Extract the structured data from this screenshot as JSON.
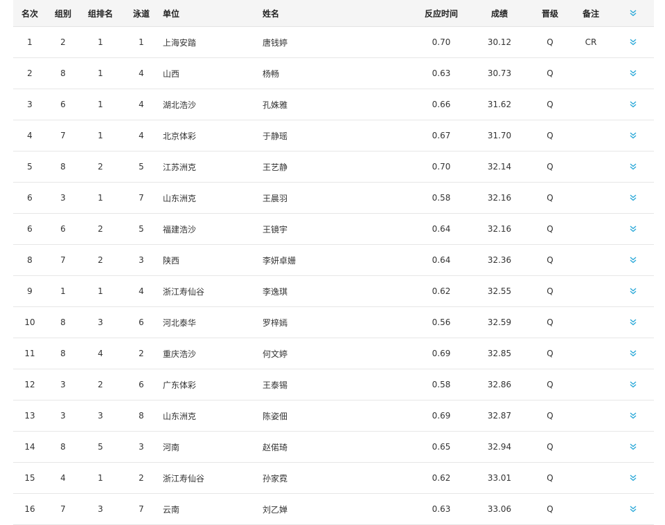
{
  "accent_color": "#29a8d8",
  "expand_icon": "double-chevron-down-icon",
  "header": {
    "rank": "名次",
    "group": "组别",
    "group_rank": "组排名",
    "lane": "泳道",
    "unit": "单位",
    "name": "姓名",
    "reaction": "反应时间",
    "result": "成绩",
    "advance": "晋级",
    "note": "备注"
  },
  "rows": [
    {
      "rank": "1",
      "group": "2",
      "group_rank": "1",
      "lane": "1",
      "unit": "上海安踏",
      "name": "唐钱婷",
      "reaction": "0.70",
      "result": "30.12",
      "advance": "Q",
      "note": "CR"
    },
    {
      "rank": "2",
      "group": "8",
      "group_rank": "1",
      "lane": "4",
      "unit": "山西",
      "name": "杨畅",
      "reaction": "0.63",
      "result": "30.73",
      "advance": "Q",
      "note": ""
    },
    {
      "rank": "3",
      "group": "6",
      "group_rank": "1",
      "lane": "4",
      "unit": "湖北浩沙",
      "name": "孔姝雅",
      "reaction": "0.66",
      "result": "31.62",
      "advance": "Q",
      "note": ""
    },
    {
      "rank": "4",
      "group": "7",
      "group_rank": "1",
      "lane": "4",
      "unit": "北京体彩",
      "name": "于静瑶",
      "reaction": "0.67",
      "result": "31.70",
      "advance": "Q",
      "note": ""
    },
    {
      "rank": "5",
      "group": "8",
      "group_rank": "2",
      "lane": "5",
      "unit": "江苏洲克",
      "name": "王艺静",
      "reaction": "0.70",
      "result": "32.14",
      "advance": "Q",
      "note": ""
    },
    {
      "rank": "6",
      "group": "3",
      "group_rank": "1",
      "lane": "7",
      "unit": "山东洲克",
      "name": "王晨羽",
      "reaction": "0.58",
      "result": "32.16",
      "advance": "Q",
      "note": ""
    },
    {
      "rank": "6",
      "group": "6",
      "group_rank": "2",
      "lane": "5",
      "unit": "福建浩沙",
      "name": "王镜宇",
      "reaction": "0.64",
      "result": "32.16",
      "advance": "Q",
      "note": ""
    },
    {
      "rank": "8",
      "group": "7",
      "group_rank": "2",
      "lane": "3",
      "unit": "陕西",
      "name": "李妍卓姗",
      "reaction": "0.64",
      "result": "32.36",
      "advance": "Q",
      "note": ""
    },
    {
      "rank": "9",
      "group": "1",
      "group_rank": "1",
      "lane": "4",
      "unit": "浙江寿仙谷",
      "name": "李逸琪",
      "reaction": "0.62",
      "result": "32.55",
      "advance": "Q",
      "note": ""
    },
    {
      "rank": "10",
      "group": "8",
      "group_rank": "3",
      "lane": "6",
      "unit": "河北泰华",
      "name": "罗梓嫣",
      "reaction": "0.56",
      "result": "32.59",
      "advance": "Q",
      "note": ""
    },
    {
      "rank": "11",
      "group": "8",
      "group_rank": "4",
      "lane": "2",
      "unit": "重庆浩沙",
      "name": "何文婷",
      "reaction": "0.69",
      "result": "32.85",
      "advance": "Q",
      "note": ""
    },
    {
      "rank": "12",
      "group": "3",
      "group_rank": "2",
      "lane": "6",
      "unit": "广东体彩",
      "name": "王泰锡",
      "reaction": "0.58",
      "result": "32.86",
      "advance": "Q",
      "note": ""
    },
    {
      "rank": "13",
      "group": "3",
      "group_rank": "3",
      "lane": "8",
      "unit": "山东洲克",
      "name": "陈姿佃",
      "reaction": "0.69",
      "result": "32.87",
      "advance": "Q",
      "note": ""
    },
    {
      "rank": "14",
      "group": "8",
      "group_rank": "5",
      "lane": "3",
      "unit": "河南",
      "name": "赵偌琦",
      "reaction": "0.65",
      "result": "32.94",
      "advance": "Q",
      "note": ""
    },
    {
      "rank": "15",
      "group": "4",
      "group_rank": "1",
      "lane": "2",
      "unit": "浙江寿仙谷",
      "name": "孙家霓",
      "reaction": "0.62",
      "result": "33.01",
      "advance": "Q",
      "note": ""
    },
    {
      "rank": "16",
      "group": "7",
      "group_rank": "3",
      "lane": "7",
      "unit": "云南",
      "name": "刘乙婵",
      "reaction": "0.63",
      "result": "33.06",
      "advance": "Q",
      "note": ""
    }
  ]
}
